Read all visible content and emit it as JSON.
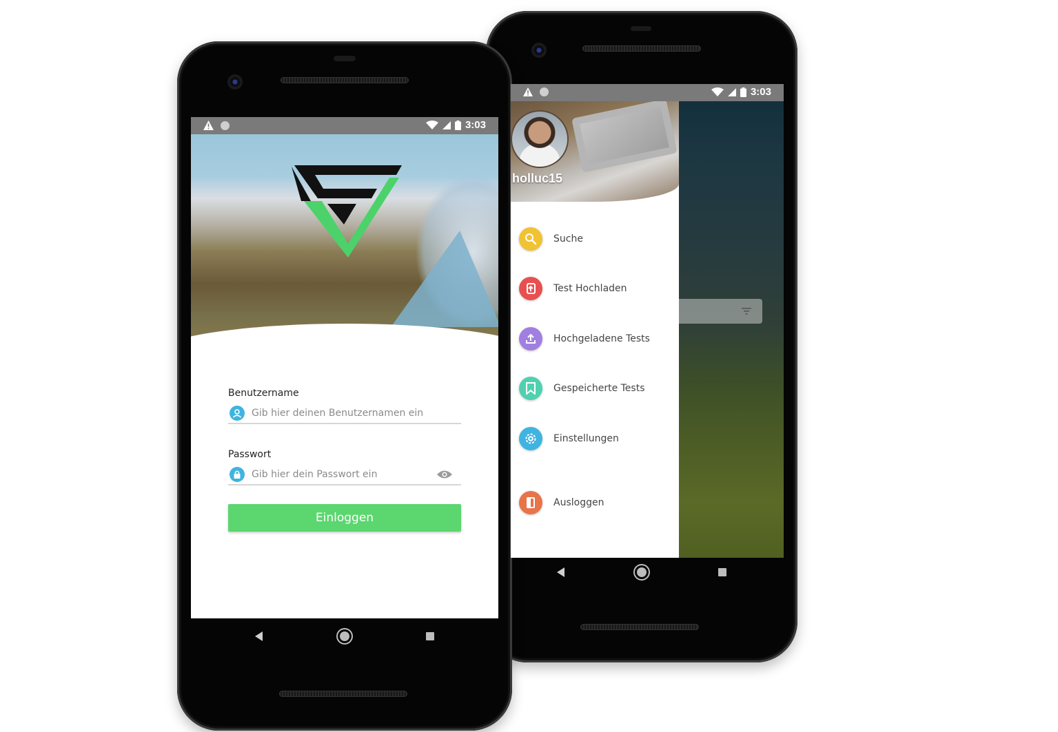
{
  "colors": {
    "accent_green": "#5cd66f",
    "field_icon_blue": "#3fb4e0",
    "search_yellow": "#f1c232",
    "upload_red": "#e8504f",
    "uploaded_purple": "#a17fe0",
    "saved_teal": "#4fd1b0",
    "settings_blue": "#3fb4e0",
    "logout_orange": "#e8744a"
  },
  "status_bar": {
    "time_front": "3:03",
    "time_back": "3:03"
  },
  "login": {
    "username_label": "Benutzername",
    "username_placeholder": "Gib hier deinen Benutzernamen ein",
    "password_label": "Passwort",
    "password_placeholder": "Gib hier dein Passwort ein",
    "login_button": "Einloggen"
  },
  "drawer": {
    "username": "holluc15",
    "items": [
      {
        "label": "Suche",
        "icon": "search-icon"
      },
      {
        "label": "Test Hochladen",
        "icon": "upload-file-icon"
      },
      {
        "label": "Hochgeladene Tests",
        "icon": "uploaded-icon"
      },
      {
        "label": "Gespeicherte Tests",
        "icon": "bookmark-icon"
      },
      {
        "label": "Einstellungen",
        "icon": "gear-icon"
      },
      {
        "label": "Ausloggen",
        "icon": "logout-icon"
      }
    ]
  }
}
